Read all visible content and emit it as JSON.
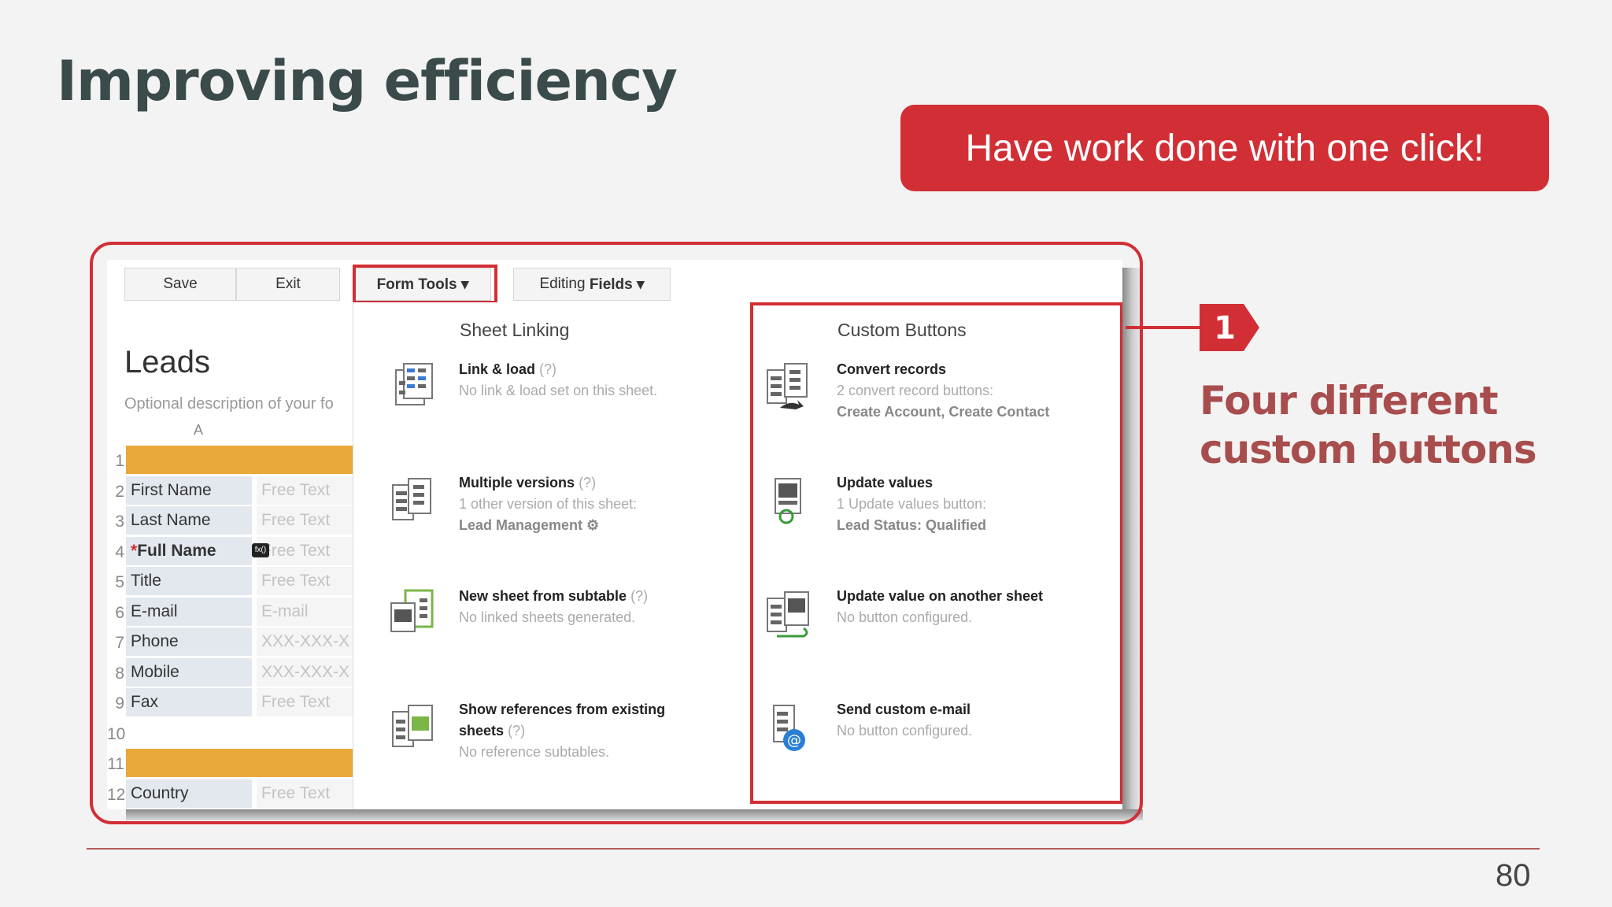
{
  "slide": {
    "title": "Improving efficiency",
    "banner": "Have work done with one click!",
    "callout_number": "1",
    "callout_text_line1": "Four different",
    "callout_text_line2": "custom buttons",
    "page_number": "80"
  },
  "toolbar": {
    "save": "Save",
    "exit": "Exit",
    "form_tools": "Form Tools ▾",
    "editing_fields_prefix": "Editing ",
    "editing_fields_bold": "Fields ▾"
  },
  "sheet": {
    "title": "Leads",
    "description": "Optional description of your fo",
    "column": "A",
    "rows": [
      {
        "num": "1",
        "label": "",
        "value": "",
        "section": true
      },
      {
        "num": "2",
        "label": "First Name",
        "value": "Free Text"
      },
      {
        "num": "3",
        "label": "Last Name",
        "value": "Free Text"
      },
      {
        "num": "4",
        "label": "*Full Name",
        "value": "Free Text",
        "formula": true
      },
      {
        "num": "5",
        "label": "Title",
        "value": "Free Text"
      },
      {
        "num": "6",
        "label": "E-mail",
        "value": "E-mail"
      },
      {
        "num": "7",
        "label": "Phone",
        "value": "XXX-XXX-X"
      },
      {
        "num": "8",
        "label": "Mobile",
        "value": "XXX-XXX-X"
      },
      {
        "num": "9",
        "label": "Fax",
        "value": "Free Text"
      },
      {
        "num": "10",
        "label": "",
        "value": "",
        "blank": true
      },
      {
        "num": "11",
        "label": "",
        "value": "",
        "section": true
      },
      {
        "num": "12",
        "label": "Country",
        "value": "Free Text"
      }
    ],
    "formula_icon": "fx()"
  },
  "menu": {
    "sheet_linking": {
      "title": "Sheet Linking",
      "items": [
        {
          "title": "Link & load",
          "q": "(?)",
          "desc": "No link & load set on this sheet.",
          "desc2": ""
        },
        {
          "title": "Multiple versions",
          "q": "(?)",
          "desc": "1 other version of this sheet:",
          "desc2": "Lead Management ⚙"
        },
        {
          "title": "New sheet from subtable",
          "q": "(?)",
          "desc": "No linked sheets generated.",
          "desc2": ""
        },
        {
          "title": "Show references from existing",
          "title2": "sheets",
          "q": "(?)",
          "desc": "No reference subtables.",
          "desc2": ""
        }
      ]
    },
    "custom_buttons": {
      "title": "Custom Buttons",
      "items": [
        {
          "title": "Convert records",
          "desc": "2 convert record buttons:",
          "desc2": "Create Account, Create Contact"
        },
        {
          "title": "Update values",
          "desc": "1 Update values button:",
          "desc2": "Lead Status: Qualified"
        },
        {
          "title": "Update value on another sheet",
          "desc": "No button configured.",
          "desc2": ""
        },
        {
          "title": "Send custom e-mail",
          "desc": "No button configured.",
          "desc2": ""
        }
      ]
    }
  },
  "colors": {
    "accent": "#d12f35",
    "title": "#3b4a4a",
    "callout_text": "#a84d4d",
    "section_bar": "#e8a83a"
  }
}
